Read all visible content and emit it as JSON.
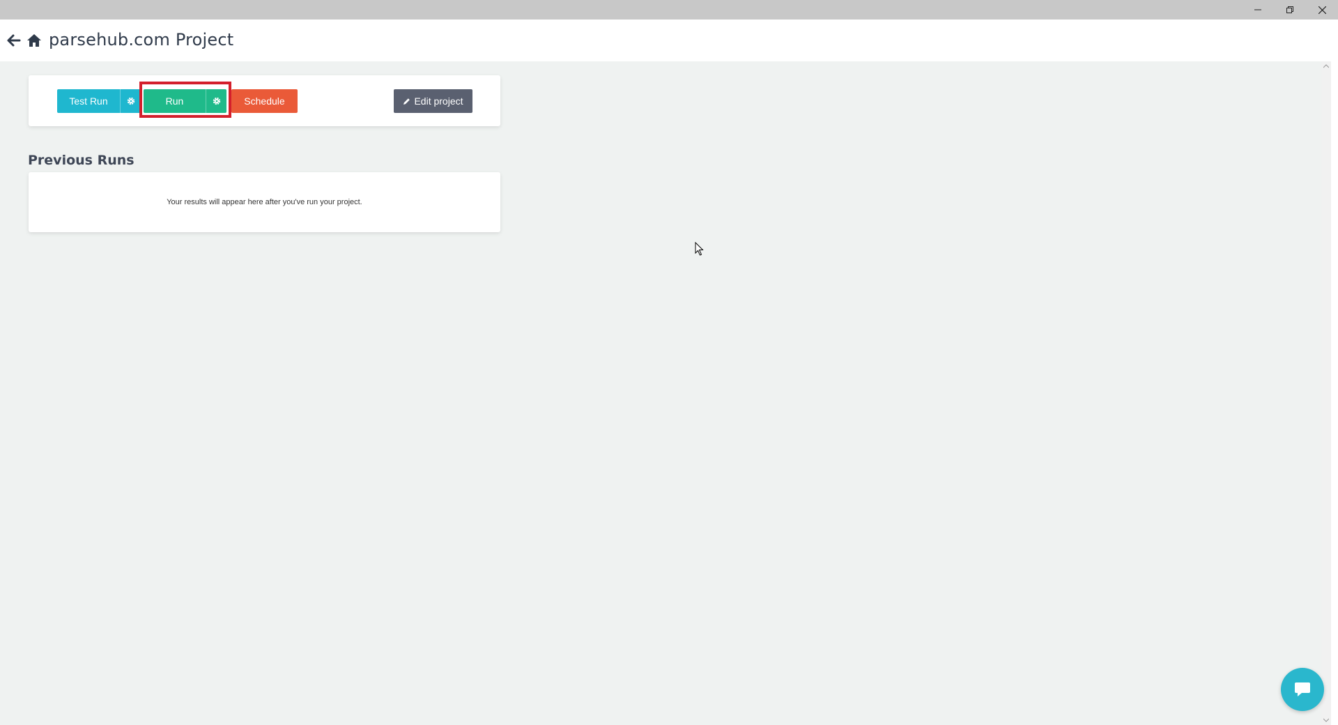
{
  "window": {
    "controls": [
      "minimize-icon",
      "restore-icon",
      "close-icon"
    ]
  },
  "header": {
    "title": "parsehub.com Project",
    "icons": [
      "back-arrow-icon",
      "home-icon"
    ]
  },
  "toolbar": {
    "test_run_label": "Test Run",
    "run_label": "Run",
    "schedule_label": "Schedule",
    "edit_label": "Edit project",
    "gear_icon": "gear-icon",
    "pencil_icon": "pencil-icon"
  },
  "previous_runs": {
    "title": "Previous Runs",
    "empty_message": "Your results will appear here after you've run your project."
  },
  "colors": {
    "test_run": "#1fb7cf",
    "run": "#1fba8a",
    "schedule": "#ea5a38",
    "edit": "#5a6070",
    "highlight": "#d4202c",
    "chat": "#2ab7cd"
  },
  "chat": {
    "icon": "chat-bubble-icon"
  }
}
